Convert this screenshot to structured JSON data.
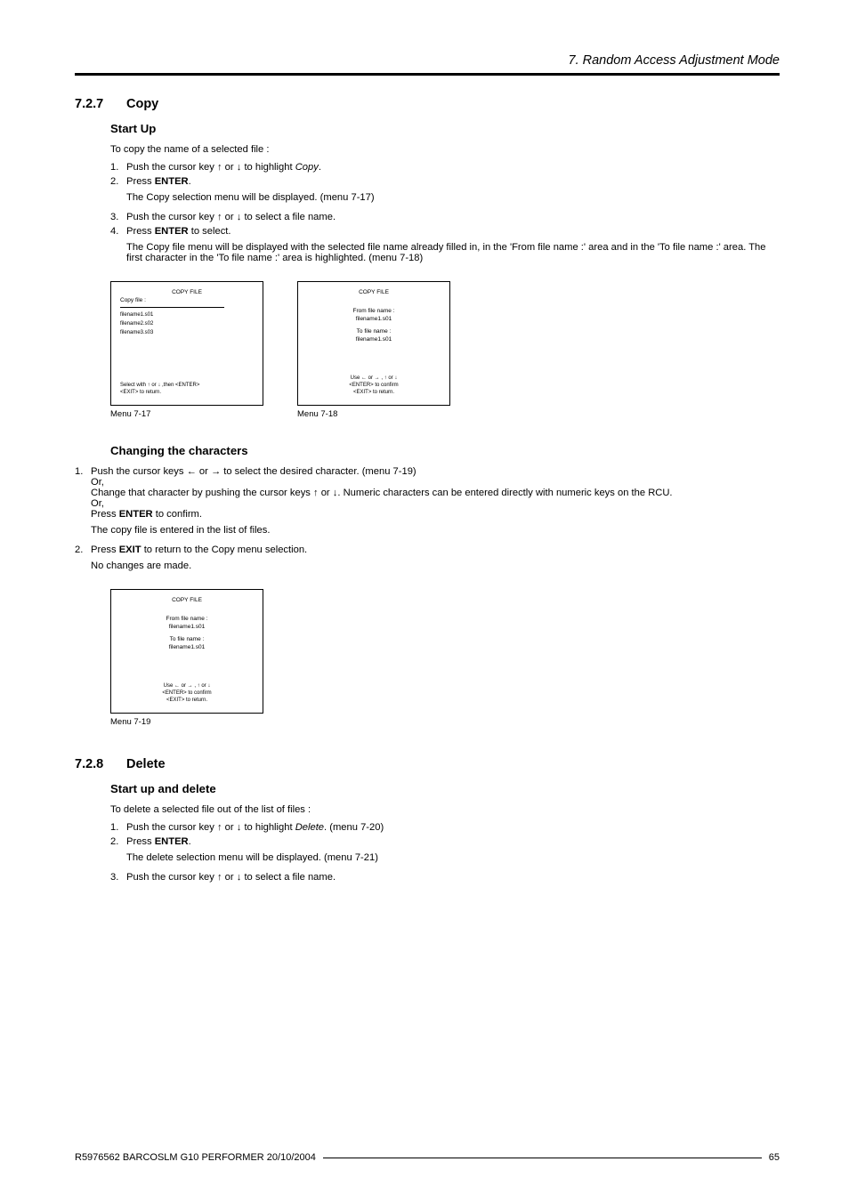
{
  "header": {
    "running": "7. Random Access Adjustment Mode"
  },
  "sec1": {
    "num": "7.2.7",
    "title": "Copy",
    "sub1": "Start Up",
    "p1": "To copy the name of a selected file :",
    "s1a": "Push the cursor key ",
    "s1b": " or ",
    "s1c": " to highlight ",
    "s1d": "Copy",
    "s1e": ".",
    "s2a": "Press ",
    "s2b": "ENTER",
    "s2c": ".",
    "s2r": "The Copy selection menu will be displayed. (menu 7-17)",
    "s3a": "Push the cursor key ",
    "s3b": " or ",
    "s3c": " to select a file name.",
    "s4a": "Press ",
    "s4b": "ENTER",
    "s4c": " to select.",
    "s4r": "The Copy file menu will be displayed with the selected file name already filled in, in the 'From file name :' area and in the 'To file name :' area.  The first character in the 'To file name :' area is highlighted. (menu 7-18)",
    "menu17": {
      "title": "COPY FILE",
      "line1": "Copy file :",
      "line2": "filename1.s01",
      "line3": "filename2.s02",
      "line4": "filename3.s03",
      "foot": "Select with ↑ or ↓ ,then <ENTER>\n<EXIT> to return.",
      "caption": "Menu 7-17"
    },
    "menu18": {
      "title": "COPY FILE",
      "l1": "From file name :",
      "l2": "filename1.s01",
      "l3": "To file name :",
      "l4": "filename1.s01",
      "foot": "Use ← or → , ↑ or ↓\n<ENTER> to confirm\n<EXIT> to return.",
      "caption": "Menu 7-18"
    },
    "sub2": "Changing the characters",
    "c1a": "Push the cursor keys ",
    "c1b": " or ",
    "c1c": " to select the desired character. (menu 7-19)",
    "c1or": "Or,",
    "c1d": "Change that character by pushing the cursor keys ",
    "c1e": " or ",
    "c1f": ". Numeric characters can be entered directly with numeric keys on the RCU.",
    "c1g": "Press ",
    "c1h": "ENTER",
    "c1i": " to confirm.",
    "c1r": "The copy file is entered in the list of files.",
    "c2a": "Press ",
    "c2b": "EXIT",
    "c2c": " to return to the Copy menu selection.",
    "c2r": "No changes are made.",
    "menu19": {
      "title": "COPY FILE",
      "l1": "From file name :",
      "l2": "filename1.s01",
      "l3": "To file name :",
      "l4": "filename1.s01",
      "foot": "Use ← or → , ↑ or ↓\n<ENTER> to confirm\n<EXIT> to return.",
      "caption": "Menu 7-19"
    }
  },
  "sec2": {
    "num": "7.2.8",
    "title": "Delete",
    "sub1": "Start up and delete",
    "p1": "To delete a selected file out of the list of files :",
    "s1a": "Push the cursor key ",
    "s1b": " or ",
    "s1c": " to highlight ",
    "s1d": "Delete",
    "s1e": ". (menu 7-20)",
    "s2a": "Press ",
    "s2b": "ENTER",
    "s2c": ".",
    "s2r": "The delete selection menu will be displayed. (menu 7-21)",
    "s3a": "Push the cursor key ",
    "s3b": " or ",
    "s3c": " to select a file name."
  },
  "footer": {
    "left": "R5976562   BARCOSLM G10 PERFORMER   20/10/2004",
    "right": "65"
  },
  "glyphs": {
    "up": "↑",
    "down": "↓",
    "left": "←",
    "right": "→"
  }
}
